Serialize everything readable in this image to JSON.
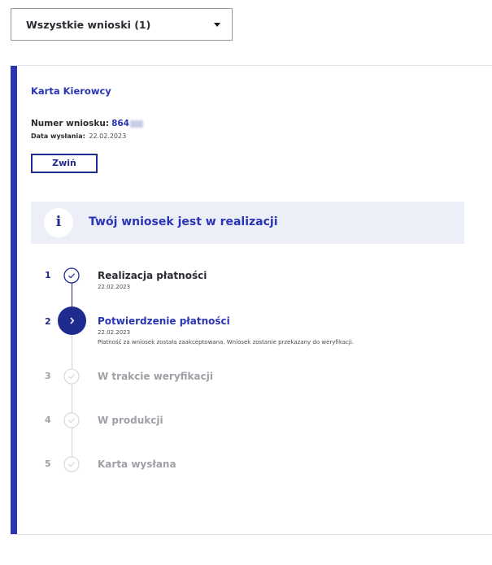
{
  "filter": {
    "label": "Wszystkie wnioski (1)",
    "icon": "caret-down-icon"
  },
  "card": {
    "title": "Karta Kierowcy",
    "application_number_label": "Numer wniosku:",
    "application_number_value": "864",
    "sent_date_label": "Data wysłania:",
    "sent_date_value": "22.02.2023",
    "collapse_button": "Zwiń"
  },
  "banner": {
    "icon": "i",
    "text": "Twój wniosek jest w realizacji"
  },
  "steps": [
    {
      "number": "1",
      "title": "Realizacja płatności",
      "date": "22.02.2023",
      "status": "done"
    },
    {
      "number": "2",
      "title": "Potwierdzenie płatności",
      "date": "22.02.2023",
      "description": "Płatność za wniosek została zaakceptowana. Wniosek zostanie przekazany do weryfikacji.",
      "status": "current"
    },
    {
      "number": "3",
      "title": "W trakcie weryfikacji",
      "status": "pending"
    },
    {
      "number": "4",
      "title": "W produkcji",
      "status": "pending"
    },
    {
      "number": "5",
      "title": "Karta wysłana",
      "status": "pending"
    }
  ],
  "colors": {
    "accent": "#2a35b5",
    "accent_dark": "#1f2b8f",
    "banner_bg": "#eceef8",
    "pending": "#a0a0a8"
  }
}
